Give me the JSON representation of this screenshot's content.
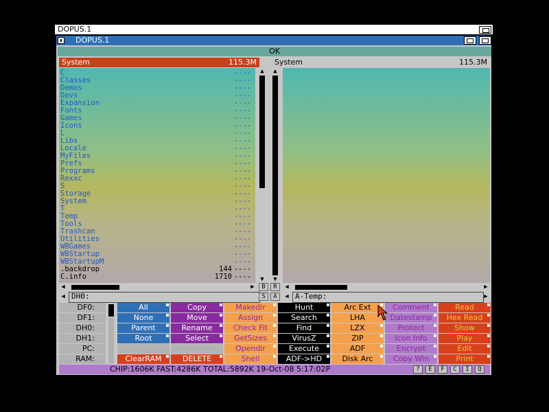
{
  "screen": {
    "title": "DOPUS.1"
  },
  "window": {
    "title": "DOPUS.1"
  },
  "ok_label": "OK",
  "left_lister": {
    "device": "System",
    "free": "115.3M",
    "path": "DH0:",
    "rows": [
      {
        "name": "C",
        "size": "",
        "dash": "----",
        "type": "dir"
      },
      {
        "name": "Classes",
        "size": "",
        "dash": "----",
        "type": "dir"
      },
      {
        "name": "Demos",
        "size": "",
        "dash": "----",
        "type": "dir"
      },
      {
        "name": "Devs",
        "size": "",
        "dash": "----",
        "type": "dir"
      },
      {
        "name": "Expansion",
        "size": "",
        "dash": "----",
        "type": "dir"
      },
      {
        "name": "Fonts",
        "size": "",
        "dash": "----",
        "type": "dir"
      },
      {
        "name": "Games",
        "size": "",
        "dash": "----",
        "type": "dir"
      },
      {
        "name": "Icons",
        "size": "",
        "dash": "----",
        "type": "dir"
      },
      {
        "name": "L",
        "size": "",
        "dash": "----",
        "type": "dir"
      },
      {
        "name": "Libs",
        "size": "",
        "dash": "----",
        "type": "dir"
      },
      {
        "name": "Locale",
        "size": "",
        "dash": "----",
        "type": "dir"
      },
      {
        "name": "MyFiles",
        "size": "",
        "dash": "----",
        "type": "dir"
      },
      {
        "name": "Prefs",
        "size": "",
        "dash": "----",
        "type": "dir"
      },
      {
        "name": "Programs",
        "size": "",
        "dash": "----",
        "type": "dir"
      },
      {
        "name": "Rexxc",
        "size": "",
        "dash": "----",
        "type": "dir"
      },
      {
        "name": "S",
        "size": "",
        "dash": "----",
        "type": "dir"
      },
      {
        "name": "Storage",
        "size": "",
        "dash": "----",
        "type": "dir"
      },
      {
        "name": "System",
        "size": "",
        "dash": "----",
        "type": "dir"
      },
      {
        "name": "T",
        "size": "",
        "dash": "----",
        "type": "dir"
      },
      {
        "name": "Temp",
        "size": "",
        "dash": "----",
        "type": "dir"
      },
      {
        "name": "Tools",
        "size": "",
        "dash": "----",
        "type": "dir"
      },
      {
        "name": "Trashcan",
        "size": "",
        "dash": "----",
        "type": "dir"
      },
      {
        "name": "Utilities",
        "size": "",
        "dash": "----",
        "type": "dir"
      },
      {
        "name": "WBGames",
        "size": "",
        "dash": "----",
        "type": "dir"
      },
      {
        "name": "WBStartup",
        "size": "",
        "dash": "----",
        "type": "dir"
      },
      {
        "name": "WBStartupM",
        "size": "",
        "dash": "----",
        "type": "dir"
      },
      {
        "name": ".backdrop",
        "size": "144",
        "dash": "----",
        "type": "file"
      },
      {
        "name": "C.info",
        "size": "1710",
        "dash": "----",
        "type": "file"
      }
    ]
  },
  "right_lister": {
    "device": "System",
    "free": "115.3M",
    "path": "A-Temp:"
  },
  "scroll_labels": {
    "b": "B",
    "r": "R",
    "s": "S",
    "a": "A"
  },
  "arrows": {
    "up": "▲",
    "down": "▼",
    "left": "◀",
    "right": "▶"
  },
  "devices": [
    "DF0:",
    "DF1:",
    "DH0:",
    "DH1:",
    "PC:",
    "RAM:"
  ],
  "colors": {
    "blue": "#2f6fb6",
    "purple": "#8a2aa0",
    "orange": "#f5a04c",
    "black": "#000000",
    "lilac": "#b07acb",
    "red": "#d8401c",
    "cyan": "#4fb8b0",
    "dir_text": "#2556c8"
  },
  "button_columns": [
    {
      "bg": "#2f6fb6",
      "fg": "#ffffff",
      "labels": [
        "All",
        "None",
        "Parent",
        "Root",
        "",
        "ClearRAM"
      ],
      "bgs": [
        "#2f6fb6",
        "#2f6fb6",
        "#2f6fb6",
        "#2f6fb6",
        "#b3b3b3",
        "#d8401c"
      ]
    },
    {
      "bg": "#8a2aa0",
      "fg": "#ffffff",
      "labels": [
        "Copy",
        "Move",
        "Rename",
        "Select",
        "",
        "DELETE"
      ],
      "bgs": [
        "#8a2aa0",
        "#8a2aa0",
        "#8a2aa0",
        "#8a2aa0",
        "#b3b3b3",
        "#d8401c"
      ]
    },
    {
      "bg": "#f5a04c",
      "fg": "#8a2aa0",
      "labels": [
        "Makedir",
        "Assign",
        "Check Fit",
        "GetSizes",
        "Opendir",
        "Shell"
      ],
      "bgs": [
        "#f5a04c",
        "#f5a04c",
        "#f5a04c",
        "#f5a04c",
        "#f5a04c",
        "#f5a04c"
      ]
    },
    {
      "bg": "#000000",
      "fg": "#ffffff",
      "labels": [
        "Hunt",
        "Search",
        "Find",
        "VirusZ",
        "Execute",
        "ADF->HD"
      ],
      "bgs": [
        "#000000",
        "#000000",
        "#000000",
        "#000000",
        "#000000",
        "#000000"
      ]
    },
    {
      "bg": "#f5a04c",
      "fg": "#000000",
      "labels": [
        "Arc Ext",
        "LHA",
        "LZX",
        "ZIP",
        "ADF",
        "Disk Arc"
      ],
      "bgs": [
        "#f5a04c",
        "#f5a04c",
        "#f5a04c",
        "#f5a04c",
        "#f5a04c",
        "#f5a04c"
      ]
    },
    {
      "bg": "#b07acb",
      "fg": "#8a2aa0",
      "labels": [
        "Comment",
        "Datestamp",
        "Protect",
        "Icon Info",
        "Encrypt",
        "Copy Win"
      ],
      "bgs": [
        "#b07acb",
        "#b07acb",
        "#b07acb",
        "#b07acb",
        "#b07acb",
        "#b07acb"
      ]
    },
    {
      "bg": "#d8401c",
      "fg": "#f5c040",
      "labels": [
        "Read",
        "Hex Read",
        "Show",
        "Play",
        "Edit",
        "Print"
      ],
      "bgs": [
        "#d8401c",
        "#d8401c",
        "#d8401c",
        "#d8401c",
        "#d8401c",
        "#d8401c"
      ]
    }
  ],
  "status": {
    "text": "CHIP:1606K  FAST:4286K  TOTAL:5892K   19-Oct-08    5:17:02P",
    "buttons": [
      "?",
      "E",
      "F",
      "C",
      "I",
      "Q"
    ]
  }
}
